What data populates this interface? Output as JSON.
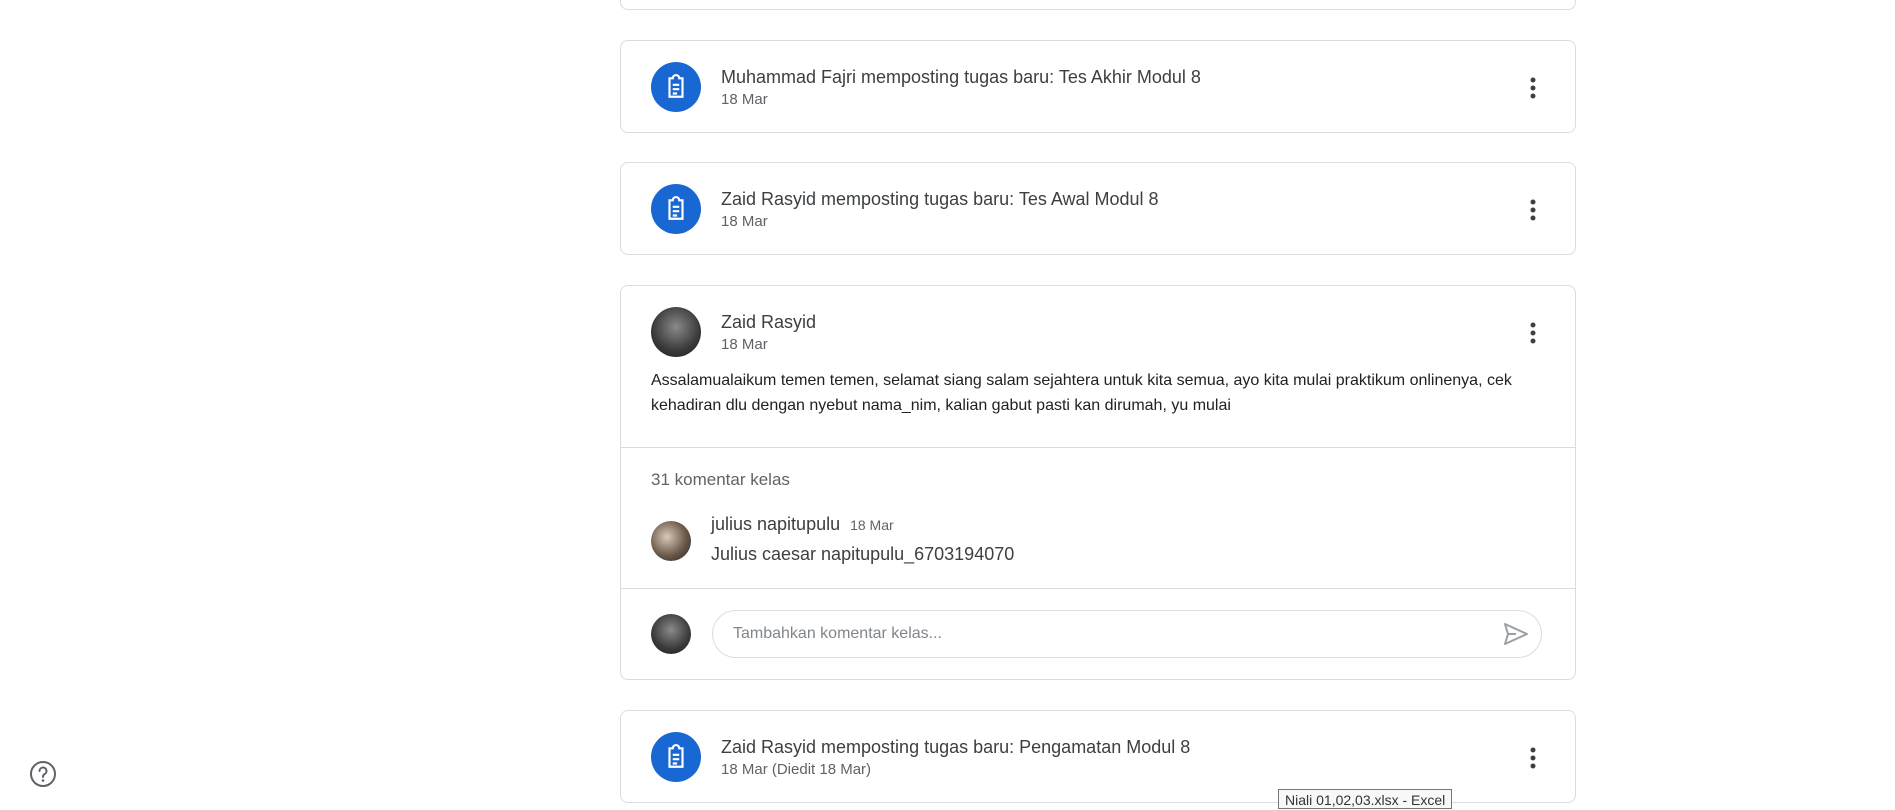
{
  "posts": [
    {
      "title": "Muhammad Fajri memposting tugas baru: Tes Akhir Modul 8",
      "date": "18 Mar"
    },
    {
      "title": "Zaid Rasyid memposting tugas baru: Tes Awal Modul 8",
      "date": "18 Mar"
    }
  ],
  "announcement": {
    "author": "Zaid Rasyid",
    "date": "18 Mar",
    "body": "Assalamualaikum temen temen, selamat siang salam sejahtera untuk kita semua, ayo kita mulai praktikum onlinenya, cek kehadiran dlu dengan nyebut nama_nim, kalian gabut pasti kan dirumah, yu mulai",
    "comment_count": "31 komentar kelas",
    "comment": {
      "author": "julius napitupulu",
      "date": "18 Mar",
      "text": "Julius caesar napitupulu_6703194070"
    },
    "comment_placeholder": "Tambahkan komentar kelas..."
  },
  "last_post": {
    "title": "Zaid Rasyid memposting tugas baru: Pengamatan Modul 8",
    "date": "18 Mar (Diedit 18 Mar)"
  },
  "tooltip": "Niali 01,02,03.xlsx - Excel",
  "icons": {
    "assignment": "assignment-icon",
    "more": "more-vert-icon",
    "send": "send-icon",
    "help": "help-icon"
  },
  "colors": {
    "accent": "#1967d2",
    "border": "#dadce0",
    "text": "#3c4043",
    "muted": "#5f6368"
  }
}
